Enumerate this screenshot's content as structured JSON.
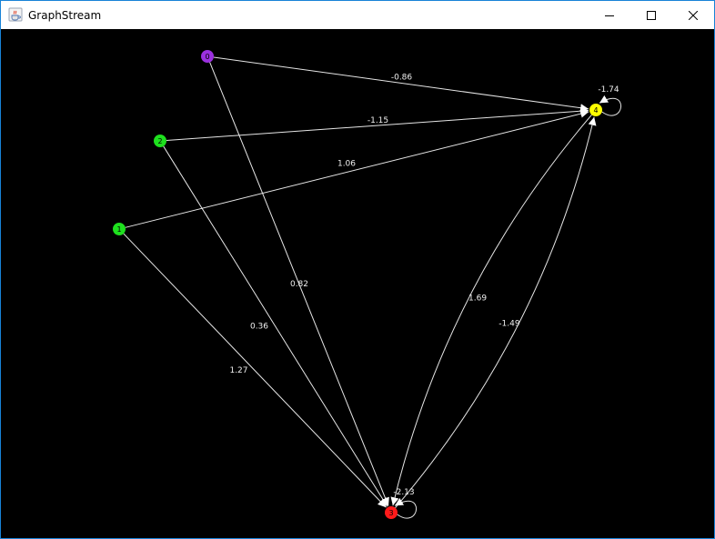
{
  "window": {
    "title": "GraphStream",
    "app_icon": "java-cup-icon",
    "controls": [
      "minimize-icon",
      "maximize-icon",
      "close-icon"
    ]
  },
  "graph": {
    "nodes": [
      {
        "id": "0",
        "label": "0",
        "color": "#9b30e0"
      },
      {
        "id": "1",
        "label": "1",
        "color": "#1ee01e"
      },
      {
        "id": "2",
        "label": "2",
        "color": "#1ee01e"
      },
      {
        "id": "3",
        "label": "3",
        "color": "#ff1a1a"
      },
      {
        "id": "4",
        "label": "4",
        "color": "#ffff00"
      }
    ],
    "edges": [
      {
        "from": "0",
        "to": "4",
        "label": "-0.86"
      },
      {
        "from": "2",
        "to": "4",
        "label": "-1.15"
      },
      {
        "from": "1",
        "to": "4",
        "label": "1.06"
      },
      {
        "from": "0",
        "to": "3",
        "label": "0.82"
      },
      {
        "from": "2",
        "to": "3",
        "label": "0.36"
      },
      {
        "from": "1",
        "to": "3",
        "label": "1.27"
      },
      {
        "from": "3",
        "to": "4",
        "label": "-1.49"
      },
      {
        "from": "4",
        "to": "3",
        "label": "1.69"
      },
      {
        "from": "4",
        "to": "4",
        "label": "-1.74"
      },
      {
        "from": "3",
        "to": "3",
        "label": "-2.13"
      }
    ]
  }
}
